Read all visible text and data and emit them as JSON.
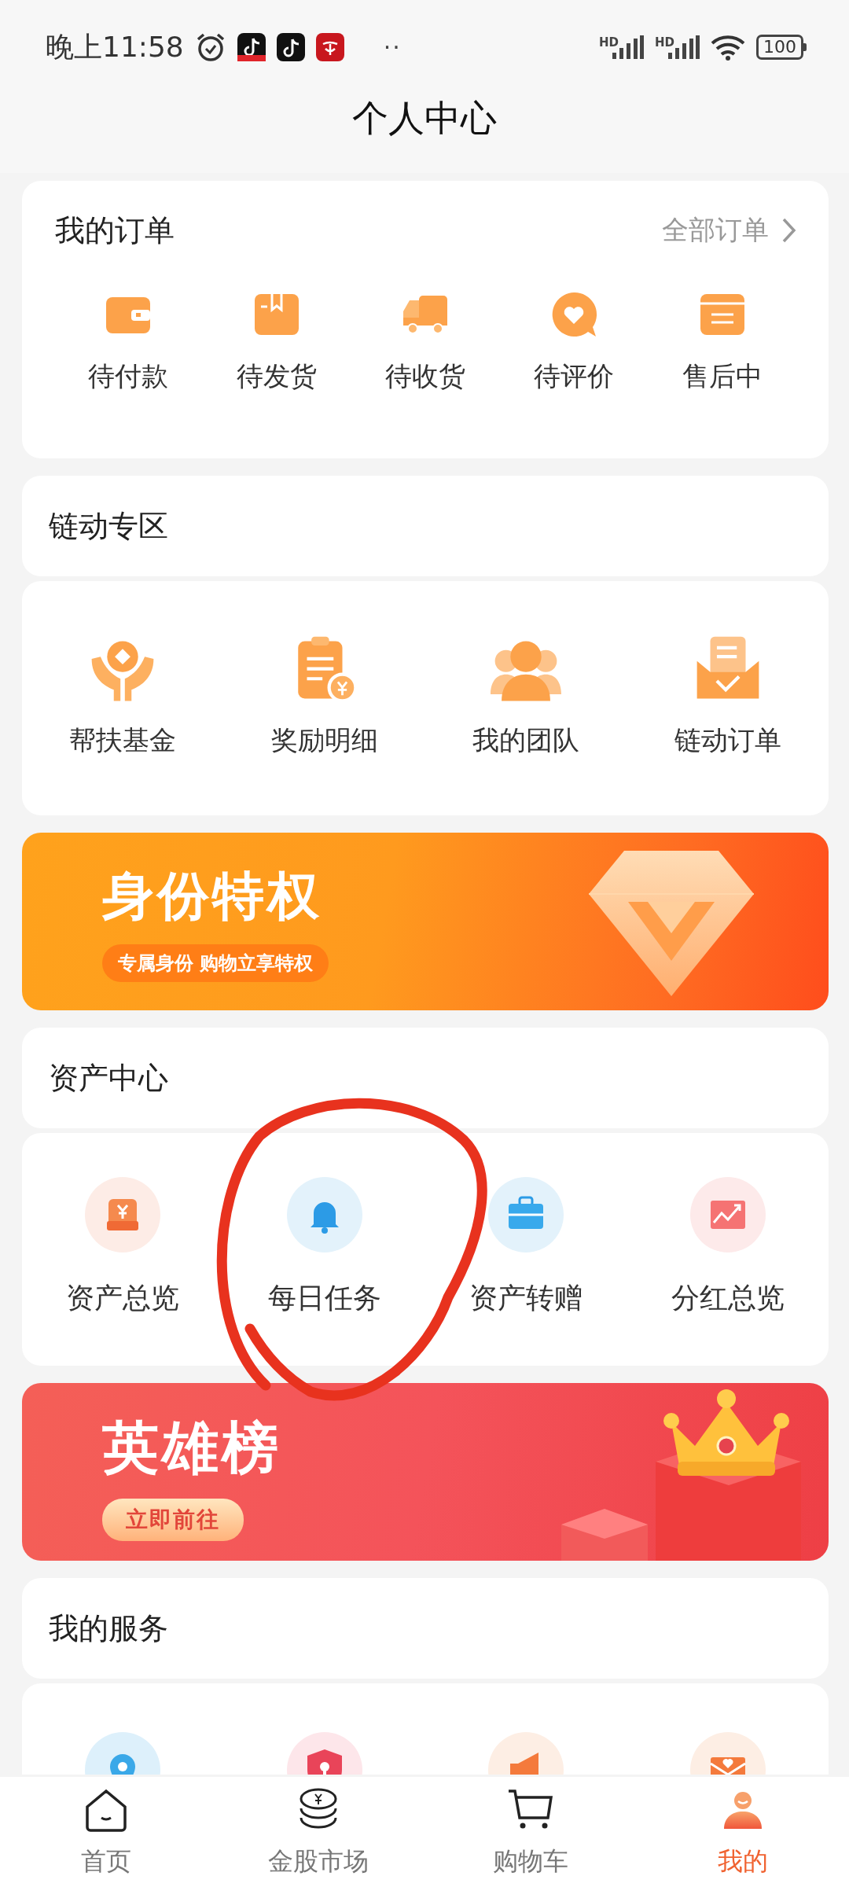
{
  "status_bar": {
    "time": "晚上11:58",
    "overflow": "··",
    "network_labels": [
      "HD",
      "HD"
    ],
    "battery": "100"
  },
  "header": {
    "title": "个人中心"
  },
  "orders": {
    "title": "我的订单",
    "link": "全部订单",
    "items": [
      {
        "label": "待付款",
        "kind": "wallet"
      },
      {
        "label": "待发货",
        "kind": "box"
      },
      {
        "label": "待收货",
        "kind": "truck"
      },
      {
        "label": "待评价",
        "kind": "bubble"
      },
      {
        "label": "售后中",
        "kind": "card"
      }
    ]
  },
  "chain_zone": {
    "title": "链动专区",
    "items": [
      {
        "label": "帮扶基金",
        "kind": "hands"
      },
      {
        "label": "奖励明细",
        "kind": "clipboard"
      },
      {
        "label": "我的团队",
        "kind": "people"
      },
      {
        "label": "链动订单",
        "kind": "tray"
      }
    ]
  },
  "privilege_banner": {
    "title": "身份特权",
    "tagline": "专属身份 购物立享特权"
  },
  "assets": {
    "title": "资产中心",
    "items": [
      {
        "label": "资产总览",
        "kind": "moneybox"
      },
      {
        "label": "每日任务",
        "kind": "bell"
      },
      {
        "label": "资产转赠",
        "kind": "briefcase"
      },
      {
        "label": "分红总览",
        "kind": "chart"
      }
    ]
  },
  "hero_banner": {
    "title": "英雄榜",
    "button": "立即前往"
  },
  "services": {
    "title": "我的服务",
    "items": [
      {
        "kind": "pin"
      },
      {
        "kind": "shield"
      },
      {
        "kind": "megaphone"
      },
      {
        "kind": "envelope"
      }
    ]
  },
  "tab_bar": [
    {
      "label": "首页",
      "kind": "home",
      "selected": false
    },
    {
      "label": "金股市场",
      "kind": "coins",
      "selected": false
    },
    {
      "label": "购物车",
      "kind": "cart",
      "selected": false
    },
    {
      "label": "我的",
      "kind": "person",
      "selected": true
    }
  ]
}
